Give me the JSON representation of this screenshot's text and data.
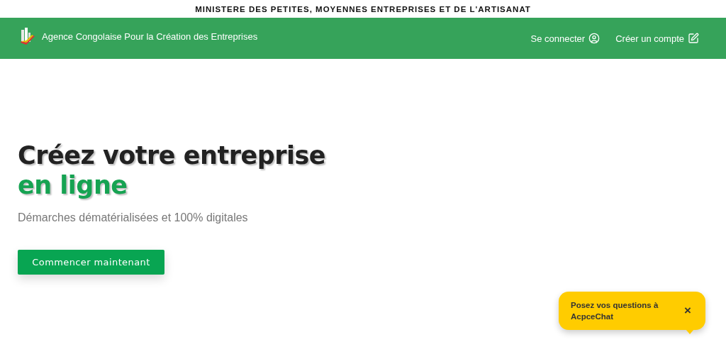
{
  "ministry_bar": {
    "title": "MINISTERE DES PETITES, MOYENNES ENTREPRISES ET DE L'ARTISANAT"
  },
  "header": {
    "brand": "Agence Congolaise Pour la Création des Entreprises",
    "nav": [
      {
        "label": "Se connecter"
      },
      {
        "label": "Créer un compte"
      }
    ]
  },
  "hero": {
    "title": "Créez votre entreprise",
    "title_highlight": "en ligne",
    "subtitle": "Démarches dématérialisées et 100% digitales",
    "cta": "Commencer maintenant"
  },
  "chat": {
    "message": "Posez vos questions à AcpceChat",
    "close": "×"
  }
}
